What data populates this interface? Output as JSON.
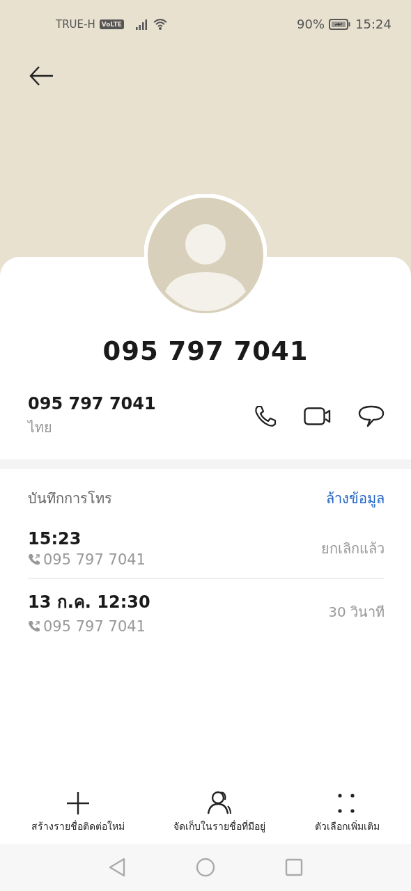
{
  "status_bar": {
    "carrier": "TRUE-H",
    "volte": "VoLTE",
    "battery": "90%",
    "time": "15:24"
  },
  "contact": {
    "title": "095 797 7041",
    "number": "095 797 7041",
    "region": "ไทย"
  },
  "call_log": {
    "title": "บันทึกการโทร",
    "clear_label": "ล้างข้อมูล",
    "entries": [
      {
        "time": "15:23",
        "number": "095 797 7041",
        "status": "ยกเลิกแล้ว"
      },
      {
        "time": "13 ก.ค. 12:30",
        "number": "095 797 7041",
        "status": "30 วินาที"
      }
    ]
  },
  "actions": [
    {
      "kind": "add",
      "label": "สร้างรายชื่อติดต่อใหม่"
    },
    {
      "kind": "contacts",
      "label": "จัดเก็บในรายชื่อที่มีอยู่"
    },
    {
      "kind": "more",
      "label": "ตัวเลือกเพิ่มเติม"
    }
  ]
}
